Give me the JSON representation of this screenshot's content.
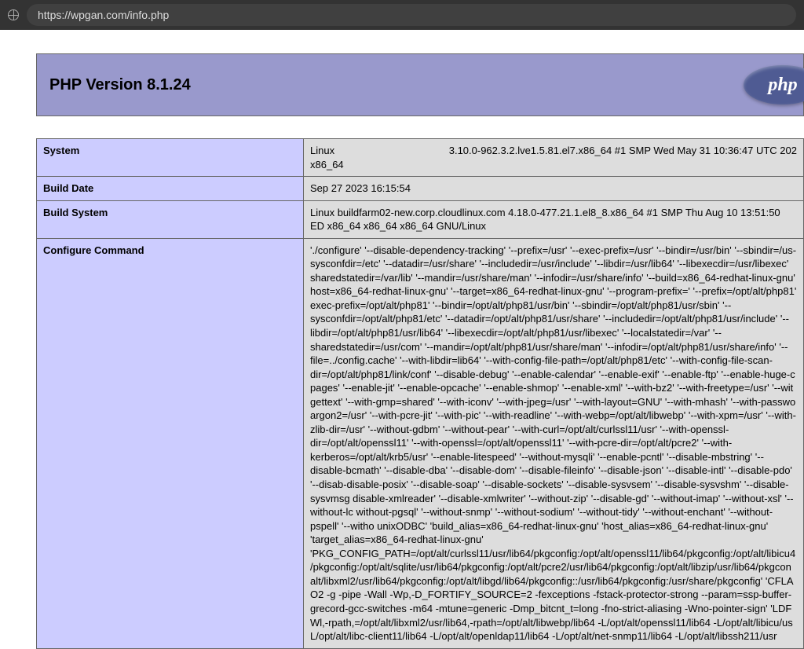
{
  "browser": {
    "url": "https://wpgan.com/info.php"
  },
  "header": {
    "title": "PHP Version 8.1.24",
    "logo_text": "php"
  },
  "rows": {
    "system": {
      "label": "System",
      "value_left": "Linux",
      "value_right": "3.10.0-962.3.2.lve1.5.81.el7.x86_64 #1 SMP Wed May 31 10:36:47 UTC 202",
      "value_below": "x86_64"
    },
    "build_date": {
      "label": "Build Date",
      "value": "Sep 27 2023 16:15:54"
    },
    "build_system": {
      "label": "Build System",
      "value": "Linux buildfarm02-new.corp.cloudlinux.com 4.18.0-477.21.1.el8_8.x86_64 #1 SMP Thu Aug 10 13:51:50 ED x86_64 x86_64 x86_64 GNU/Linux"
    },
    "configure": {
      "label": "Configure Command",
      "value": "'./configure' '--disable-dependency-tracking' '--prefix=/usr' '--exec-prefix=/usr' '--bindir=/usr/bin' '--sbindir=/us-sysconfdir=/etc' '--datadir=/usr/share' '--includedir=/usr/include' '--libdir=/usr/lib64' '--libexecdir=/usr/libexec' sharedstatedir=/var/lib' '--mandir=/usr/share/man' '--infodir=/usr/share/info' '--build=x86_64-redhat-linux-gnu' host=x86_64-redhat-linux-gnu' '--target=x86_64-redhat-linux-gnu' '--program-prefix=' '--prefix=/opt/alt/php81' exec-prefix=/opt/alt/php81' '--bindir=/opt/alt/php81/usr/bin' '--sbindir=/opt/alt/php81/usr/sbin' '--sysconfdir=/opt/alt/php81/etc' '--datadir=/opt/alt/php81/usr/share' '--includedir=/opt/alt/php81/usr/include' '--libdir=/opt/alt/php81/usr/lib64' '--libexecdir=/opt/alt/php81/usr/libexec' '--localstatedir=/var' '--sharedstatedir=/usr/com' '--mandir=/opt/alt/php81/usr/share/man' '--infodir=/opt/alt/php81/usr/share/info' '--file=../config.cache' '--with-libdir=lib64' '--with-config-file-path=/opt/alt/php81/etc' '--with-config-file-scan-dir=/opt/alt/php81/link/conf' '--disable-debug' '--enable-calendar' '--enable-exif' '--enable-ftp' '--enable-huge-c pages' '--enable-jit' '--enable-opcache' '--enable-shmop' '--enable-xml' '--with-bz2' '--with-freetype=/usr' '--wit gettext' '--with-gmp=shared' '--with-iconv' '--with-jpeg=/usr' '--with-layout=GNU' '--with-mhash' '--with-passwo argon2=/usr' '--with-pcre-jit' '--with-pic' '--with-readline' '--with-webp=/opt/alt/libwebp' '--with-xpm=/usr' '--with-zlib-dir=/usr' '--without-gdbm' '--without-pear' '--with-curl=/opt/alt/curlssl11/usr' '--with-openssl-dir=/opt/alt/openssl11' '--with-openssl=/opt/alt/openssl11' '--with-pcre-dir=/opt/alt/pcre2' '--with-kerberos=/opt/alt/krb5/usr' '--enable-litespeed' '--without-mysqli' '--enable-pcntl' '--disable-mbstring' '--disable-bcmath' '--disable-dba' '--disable-dom' '--disable-fileinfo' '--disable-json' '--disable-intl' '--disable-pdo' '--disab-disable-posix' '--disable-soap' '--disable-sockets' '--disable-sysvsem' '--disable-sysvshm' '--disable-sysvmsg disable-xmlreader' '--disable-xmlwriter' '--without-zip' '--disable-gd' '--without-imap' '--without-xsl' '--without-lc without-pgsql' '--without-snmp' '--without-sodium' '--without-tidy' '--without-enchant' '--without-pspell' '--witho unixODBC' 'build_alias=x86_64-redhat-linux-gnu' 'host_alias=x86_64-redhat-linux-gnu' 'target_alias=x86_64-redhat-linux-gnu' 'PKG_CONFIG_PATH=/opt/alt/curlssl11/usr/lib64/pkgconfig:/opt/alt/openssl11/lib64/pkgconfig:/opt/alt/libicu4/pkgconfig:/opt/alt/sqlite/usr/lib64/pkgconfig:/opt/alt/pcre2/usr/lib64/pkgconfig:/opt/alt/libzip/usr/lib64/pkgcon alt/libxml2/usr/lib64/pkgconfig:/opt/alt/libgd/lib64/pkgconfig::/usr/lib64/pkgconfig:/usr/share/pkgconfig' 'CFLA O2 -g -pipe -Wall -Wp,-D_FORTIFY_SOURCE=2 -fexceptions -fstack-protector-strong --param=ssp-buffer-grecord-gcc-switches -m64 -mtune=generic -Dmp_bitcnt_t=long -fno-strict-aliasing -Wno-pointer-sign' 'LDF Wl,-rpath,=/opt/alt/libxml2/usr/lib64,-rpath=/opt/alt/libwebp/lib64 -L/opt/alt/openssl11/lib64 -L/opt/alt/libicu/us L/opt/alt/libc-client11/lib64 -L/opt/alt/openldap11/lib64 -L/opt/alt/net-snmp11/lib64 -L/opt/alt/libssh211/usr"
    }
  }
}
